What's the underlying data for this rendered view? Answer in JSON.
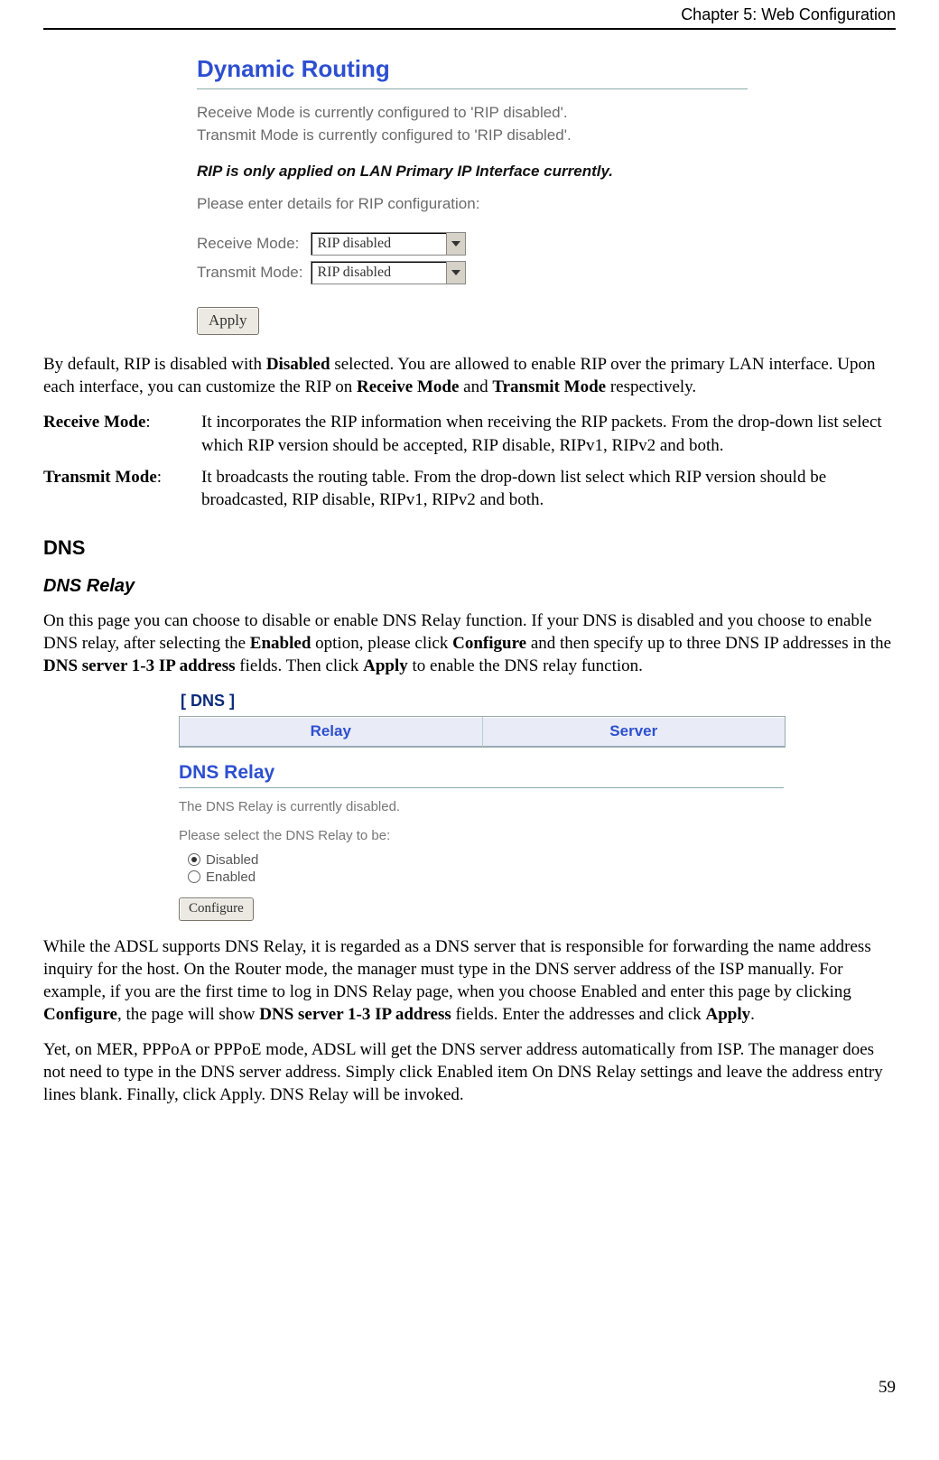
{
  "header": {
    "chapter": "Chapter 5: Web Configuration"
  },
  "dr": {
    "title": "Dynamic Routing",
    "status1": "Receive Mode is currently configured to 'RIP disabled'.",
    "status2": "Transmit Mode is currently configured to 'RIP disabled'.",
    "note": "RIP is only applied on LAN Primary IP Interface currently.",
    "prompt": "Please enter details for RIP configuration:",
    "rx_label": "Receive Mode:",
    "tx_label": "Transmit Mode:",
    "rx_value": "RIP disabled",
    "tx_value": "RIP disabled",
    "apply": "Apply"
  },
  "p1_a": "By default, RIP is disabled with ",
  "p1_b": "Disabled",
  "p1_c": " selected. You are allowed to enable RIP over the primary LAN interface. Upon each interface, you can customize the RIP on ",
  "p1_d": "Receive Mode",
  "p1_e": " and ",
  "p1_f": "Transmit Mode",
  "p1_g": " respectively.",
  "def1": {
    "term": "Receive Mode",
    "desc": "It incorporates the RIP information when receiving the RIP packets. From the drop-down list select which RIP version should be accepted, RIP disable, RIPv1, RIPv2 and both."
  },
  "def2": {
    "term": "Transmit Mode",
    "desc": "It broadcasts the routing table. From the drop-down list select which RIP version should be broadcasted, RIP disable, RIPv1, RIPv2 and both."
  },
  "h_dns": "DNS",
  "h_relay": "DNS Relay",
  "p2_a": "On this page you can choose to disable or enable DNS Relay function. If your DNS is disabled and you choose to enable DNS relay, after selecting the ",
  "p2_b": "Enabled",
  "p2_c": " option, please click ",
  "p2_d": "Configure",
  "p2_e": " and then specify up to three DNS IP addresses in the ",
  "p2_f": "DNS server 1-3 IP address",
  "p2_g": " fields. Then click ",
  "p2_h": "Apply",
  "p2_i": " to enable the DNS relay function.",
  "dns": {
    "crumb": "[ DNS ]",
    "tab1": "Relay",
    "tab2": "Server",
    "subtitle": "DNS Relay",
    "status": "The DNS Relay is currently disabled.",
    "prompt": "Please select the DNS Relay to be:",
    "opt_disabled": "Disabled",
    "opt_enabled": "Enabled",
    "configure": "Configure"
  },
  "p3_a": "While the ADSL supports DNS Relay, it is regarded as a DNS server that is responsible for forwarding the name address inquiry for the host. On the Router mode, the manager must type in the DNS server address of the ISP manually. For example, if you are the first time to log in DNS Relay page, when you choose Enabled and enter this page by clicking ",
  "p3_b": "Configure",
  "p3_c": ", the page will show ",
  "p3_d": "DNS server 1-3 IP address",
  "p3_e": " fields. Enter the addresses and click ",
  "p3_f": "Apply",
  "p3_g": ".",
  "p4": "Yet, on MER, PPPoA or PPPoE mode, ADSL will get the DNS server address automatically from ISP. The manager does not need to type in the DNS server address. Simply click Enabled item On DNS Relay settings and leave the address entry lines blank. Finally, click Apply. DNS Relay will be invoked.",
  "page_num": "59"
}
